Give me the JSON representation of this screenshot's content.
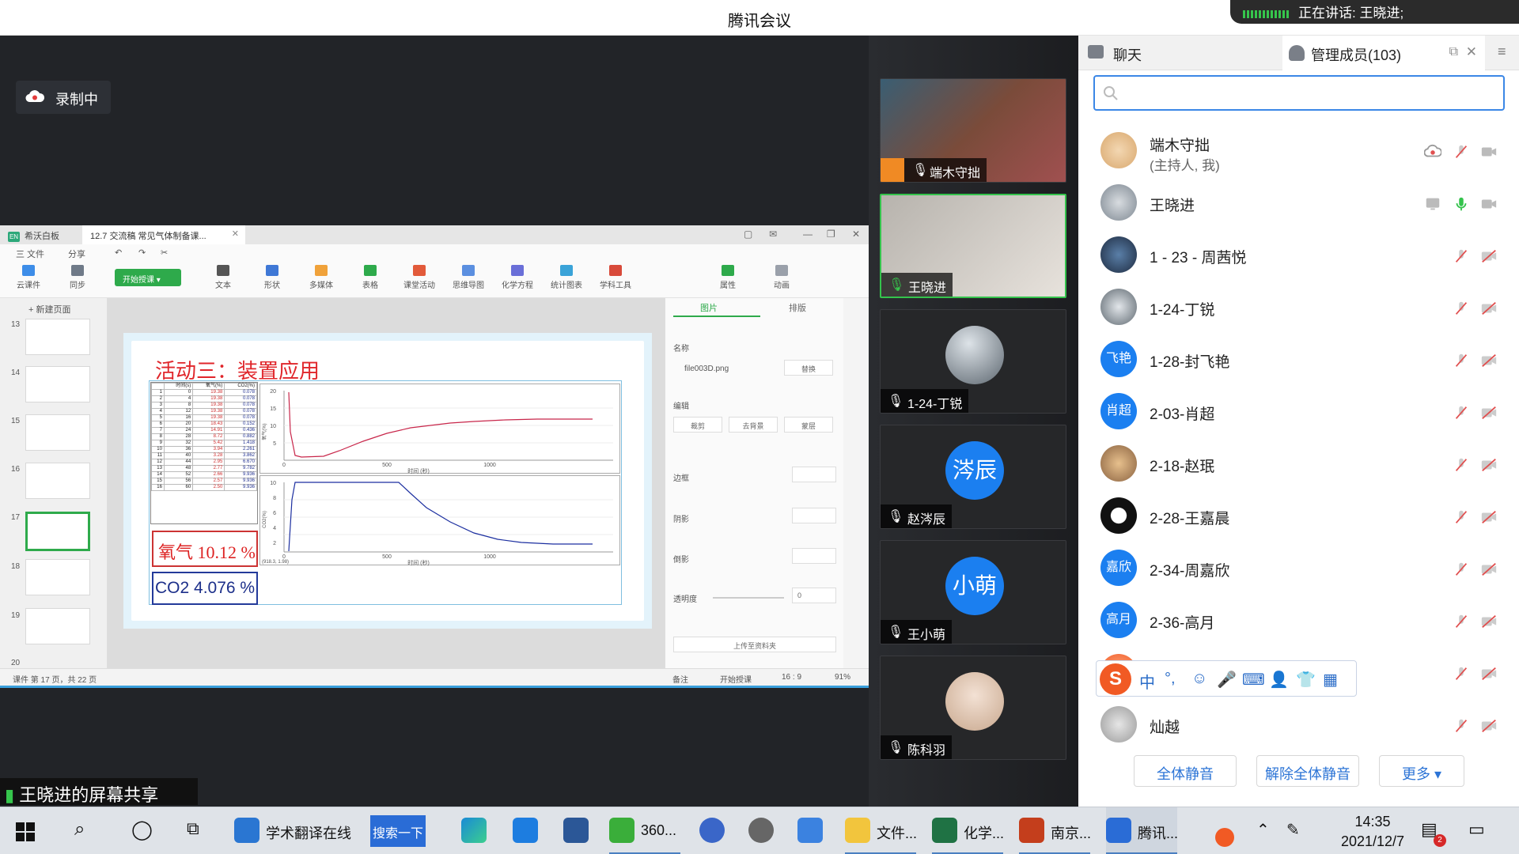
{
  "window": {
    "title": "腾讯会议",
    "speaking": "正在讲话: 王晓进;"
  },
  "recording": {
    "label": "录制中"
  },
  "whiteboard": {
    "app_tab": "希沃白板",
    "doc_tab": "12.7 交流稿 常见气体制备课...",
    "menu": {
      "file": "三 文件",
      "share": "分享"
    },
    "ribbon": {
      "cloud": "云课件",
      "sync": "同步",
      "start": "开始授课",
      "text": "文本",
      "shape": "形状",
      "media": "多媒体",
      "table": "表格",
      "activity": "课堂活动",
      "mindmap": "思维导图",
      "equation": "化学方程",
      "stats": "统计图表",
      "subject": "学科工具",
      "attr": "属性",
      "anim": "动画"
    },
    "new_page": "新建页面",
    "thumb_numbers": [
      "13",
      "14",
      "15",
      "16",
      "17",
      "18",
      "19",
      "20"
    ],
    "slide": {
      "title": "活动三：装置应用",
      "table_headers": [
        "时间(s)",
        "氧气(%)",
        "CO2(%)"
      ],
      "table_rows": [
        [
          "1",
          "0",
          "19.38",
          "0.078"
        ],
        [
          "2",
          "4",
          "19.38",
          "0.078"
        ],
        [
          "3",
          "8",
          "19.38",
          "0.078"
        ],
        [
          "4",
          "12",
          "19.38",
          "0.078"
        ],
        [
          "5",
          "16",
          "19.38",
          "0.078"
        ],
        [
          "6",
          "20",
          "18.43",
          "0.152"
        ],
        [
          "7",
          "24",
          "14.91",
          "0.436"
        ],
        [
          "8",
          "28",
          "8.72",
          "0.882"
        ],
        [
          "9",
          "32",
          "5.42",
          "1.418"
        ],
        [
          "10",
          "36",
          "3.94",
          "2.261"
        ],
        [
          "11",
          "40",
          "3.28",
          "3.862"
        ],
        [
          "12",
          "44",
          "2.95",
          "6.670"
        ],
        [
          "13",
          "48",
          "2.77",
          "9.782"
        ],
        [
          "14",
          "52",
          "2.66",
          "9.936"
        ],
        [
          "15",
          "56",
          "2.57",
          "9.936"
        ],
        [
          "16",
          "60",
          "2.50",
          "9.936"
        ]
      ],
      "oxygen_label": "氧气 10.12 %",
      "co2_label": "CO2 4.076 %",
      "chart1_ylabel": "氧气(%)",
      "chart2_ylabel": "CO2(%)",
      "chart_xlabel": "时间 (秒)",
      "chart1_yticks": [
        "20",
        "15",
        "10",
        "5"
      ],
      "chart2_yticks": [
        "10",
        "8",
        "6",
        "4",
        "2"
      ],
      "chart_xticks": [
        "0",
        "500",
        "1000"
      ],
      "chart2_corner": "(918.3, 1.98)"
    },
    "right_panel": {
      "tab_image": "图片",
      "tab_layout": "排版",
      "name_label": "名称",
      "file": "file003D.png",
      "replace": "替换",
      "edit_label": "编辑",
      "crop": "裁剪",
      "remove_bg": "去背景",
      "mask": "蒙层",
      "border": "边框",
      "shadow": "阴影",
      "reflect": "倒影",
      "opacity": "透明度",
      "opacity_value": "0",
      "upload": "上传至资料夹"
    },
    "status": {
      "page": "课件 第 17 页，共 22 页",
      "notes": "备注",
      "start": "开始授课",
      "ratio": "16 : 9",
      "zoom": "91%"
    }
  },
  "screen_share_label": "王晓进的屏幕共享",
  "videos": [
    {
      "name": "端木守拙"
    },
    {
      "name": "王晓进"
    },
    {
      "name": "1-24-丁锐"
    },
    {
      "name": "赵涔辰",
      "avatar_text": "涔辰",
      "color": "#1b7ff0"
    },
    {
      "name": "王小萌",
      "avatar_text": "小萌",
      "color": "#1b7ff0"
    },
    {
      "name": "陈科羽"
    }
  ],
  "panel": {
    "tab_chat": "聊天",
    "tab_members": "管理成员(103)",
    "members": [
      {
        "name": "端木守拙",
        "sub": "(主持人, 我)"
      },
      {
        "name": "王晓进"
      },
      {
        "name": "1 - 23 - 周茜悦"
      },
      {
        "name": "1-24-丁锐"
      },
      {
        "name": "1-28-封飞艳",
        "avatar_text": "飞艳"
      },
      {
        "name": "2-03-肖超",
        "avatar_text": "肖超"
      },
      {
        "name": "2-18-赵珉"
      },
      {
        "name": "2-28-王嘉晨"
      },
      {
        "name": "2-34-周嘉欣",
        "avatar_text": "嘉欣"
      },
      {
        "name": "2-36-高月",
        "avatar_text": "高月"
      },
      {
        "name": ""
      },
      {
        "name": "灿越"
      }
    ],
    "mute_all": "全体静音",
    "unmute_all": "解除全体静音",
    "more": "更多 ▾",
    "ime": {
      "lang": "中",
      "punct": "°,"
    }
  },
  "colors": {
    "accent": "#2c74d6",
    "green": "#34c34c",
    "muted_red": "#e05050"
  },
  "taskbar": {
    "translate": "学术翻译在线",
    "search_btn": "搜索一下",
    "app_360": "360...",
    "explorer": "文件...",
    "excel": "化学...",
    "ppt": "南京...",
    "tencent": "腾讯...",
    "time": "14:35",
    "date": "2021/12/7",
    "notif": "2"
  }
}
